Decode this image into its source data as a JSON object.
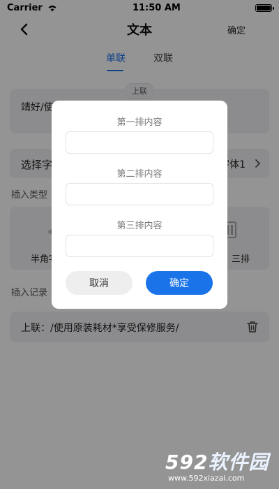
{
  "status_bar": {
    "carrier": "Carrier",
    "time": "11:50 AM"
  },
  "nav": {
    "title": "文本",
    "confirm": "确定"
  },
  "tabs": [
    {
      "label": "单联",
      "active": true
    },
    {
      "label": "双联",
      "active": false
    }
  ],
  "text_card": {
    "badge": "上联",
    "content": "靖好/使"
  },
  "font_row": {
    "label": "选择字",
    "value": "字体1"
  },
  "insert_type": {
    "label": "插入类型",
    "left_label": "半角字",
    "right_label": "三排"
  },
  "insert_record": {
    "label": "插入记录",
    "item": "上联：/使用原装耗材*享受保修服务/"
  },
  "dialog": {
    "field1_label": "第一排内容",
    "field2_label": "第二排内容",
    "field3_label": "第三排内容",
    "field1_value": "",
    "field2_value": "",
    "field3_value": "",
    "cancel": "取消",
    "ok": "确定"
  },
  "watermark": {
    "brand_num": "592",
    "brand_cn": "软件园",
    "url": "www.592xiazai.com"
  },
  "colors": {
    "accent": "#1a73e8",
    "overlay": "rgba(0,0,0,0.42)",
    "card_bg": "#f1f2f4"
  }
}
